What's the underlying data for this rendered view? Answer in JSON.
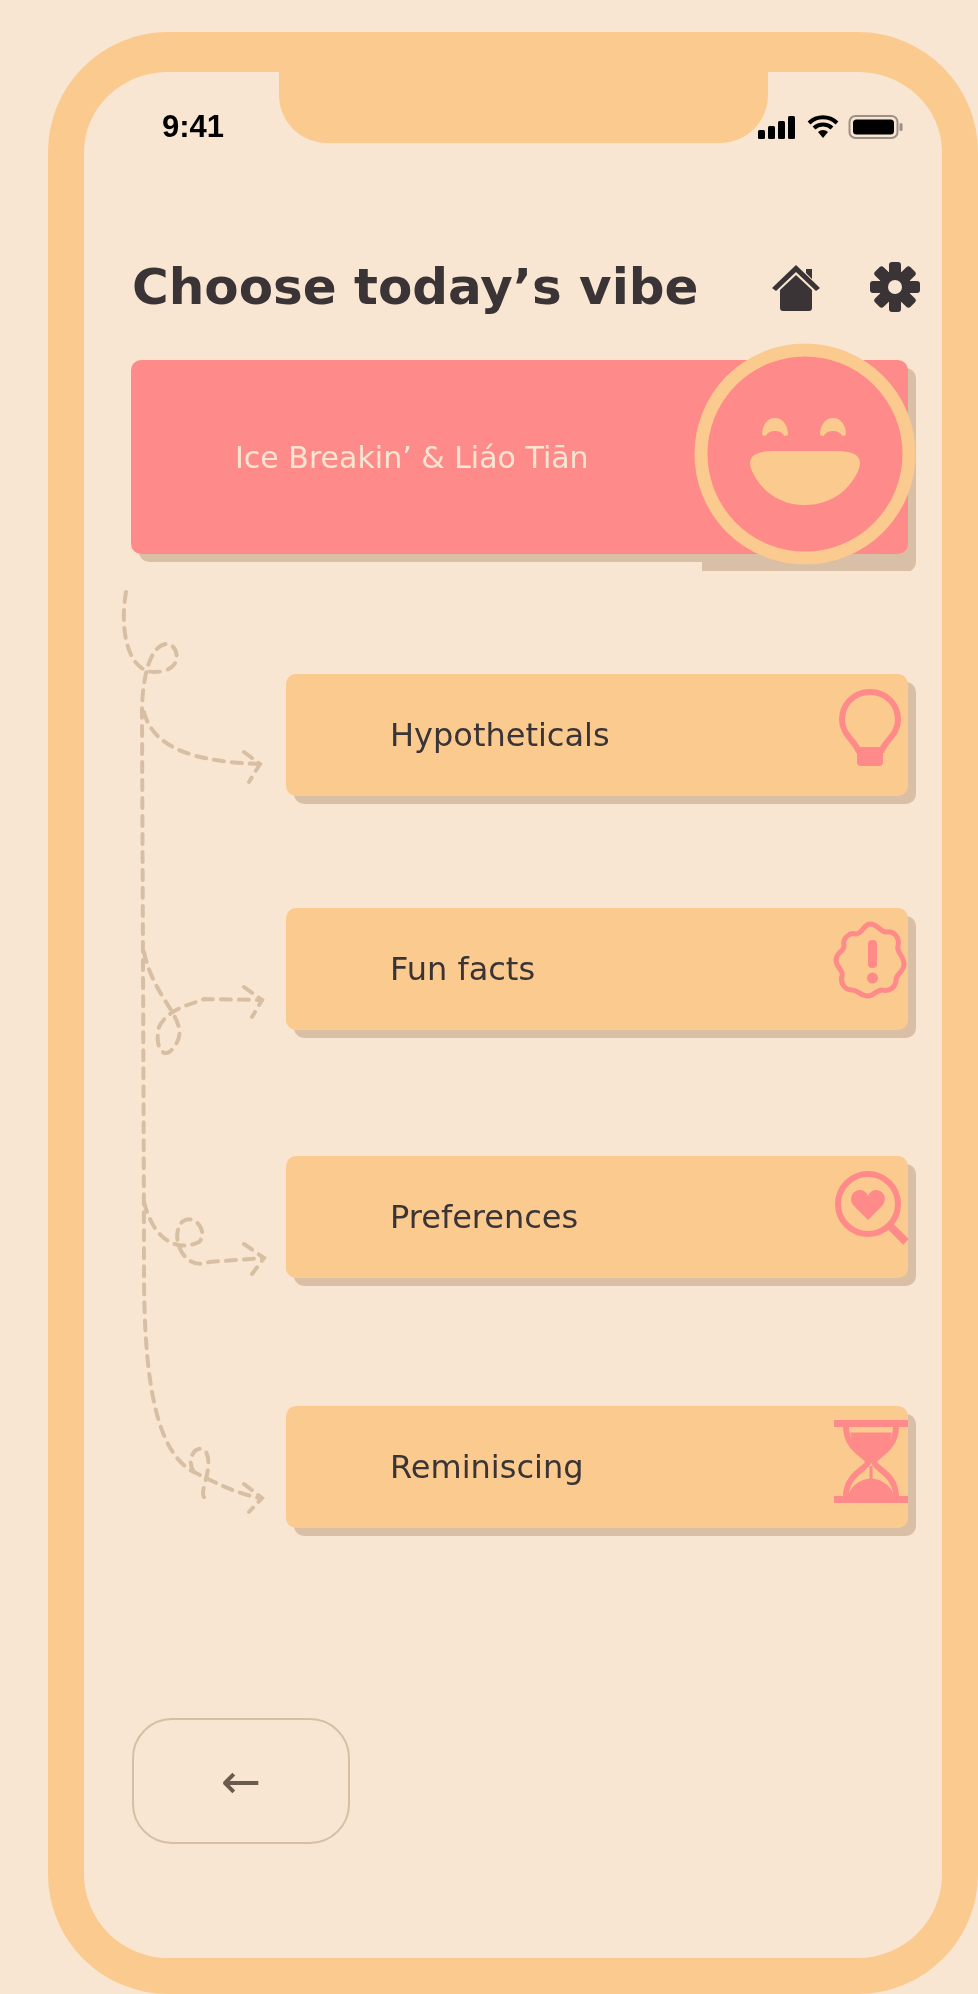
{
  "status_bar": {
    "time": "9:41"
  },
  "header": {
    "title": "Choose today’s vibe"
  },
  "topics": [
    {
      "kind": "main",
      "label": "Ice Breakin’ & Liáo Tiān"
    },
    {
      "kind": "option",
      "label": "Hypotheticals"
    },
    {
      "kind": "option",
      "label": "Fun facts"
    },
    {
      "kind": "option",
      "label": "Preferences"
    },
    {
      "kind": "option",
      "label": "Reminiscing"
    }
  ],
  "back_button": {
    "label": "←"
  }
}
